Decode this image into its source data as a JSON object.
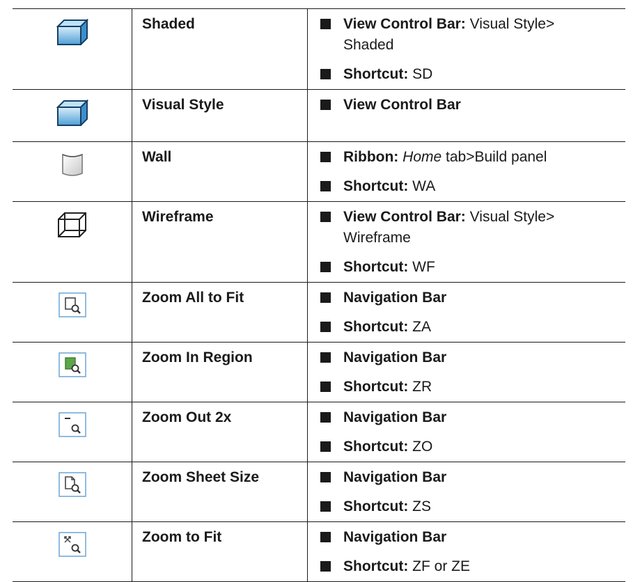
{
  "rows": [
    {
      "name": "Shaded",
      "icon": "shaded-box-icon",
      "items": [
        {
          "label": "View Control Bar:",
          "text": " Visual Style>",
          "line2": "Shaded"
        },
        {
          "label": "Shortcut:",
          "text": " SD"
        }
      ]
    },
    {
      "name": "Visual Style",
      "icon": "visual-style-box-icon",
      "items": [
        {
          "label": "View Control Bar"
        }
      ]
    },
    {
      "name": "Wall",
      "icon": "wall-icon",
      "items": [
        {
          "label": "Ribbon:",
          "em": "Home",
          "text": " tab>Build panel"
        },
        {
          "label": "Shortcut:",
          "text": " WA"
        }
      ]
    },
    {
      "name": "Wireframe",
      "icon": "wireframe-box-icon",
      "items": [
        {
          "label": "View Control Bar:",
          "text": " Visual Style>",
          "line2": "Wireframe"
        },
        {
          "label": "Shortcut:",
          "text": " WF"
        }
      ]
    },
    {
      "name": "Zoom All to Fit",
      "icon": "zoom-all-to-fit-icon",
      "items": [
        {
          "label": "Navigation Bar"
        },
        {
          "label": "Shortcut:",
          "text": " ZA"
        }
      ]
    },
    {
      "name": "Zoom In Region",
      "icon": "zoom-in-region-icon",
      "items": [
        {
          "label": "Navigation Bar"
        },
        {
          "label": "Shortcut:",
          "text": " ZR"
        }
      ]
    },
    {
      "name": "Zoom Out 2x",
      "icon": "zoom-out-2x-icon",
      "items": [
        {
          "label": "Navigation Bar"
        },
        {
          "label": "Shortcut:",
          "text": " ZO"
        }
      ]
    },
    {
      "name": "Zoom Sheet Size",
      "icon": "zoom-sheet-size-icon",
      "items": [
        {
          "label": "Navigation Bar"
        },
        {
          "label": "Shortcut:",
          "text": " ZS"
        }
      ]
    },
    {
      "name": "Zoom to Fit",
      "icon": "zoom-to-fit-icon",
      "items": [
        {
          "label": "Navigation Bar"
        },
        {
          "label": "Shortcut:",
          "text": " ZF or ZE"
        }
      ]
    }
  ]
}
